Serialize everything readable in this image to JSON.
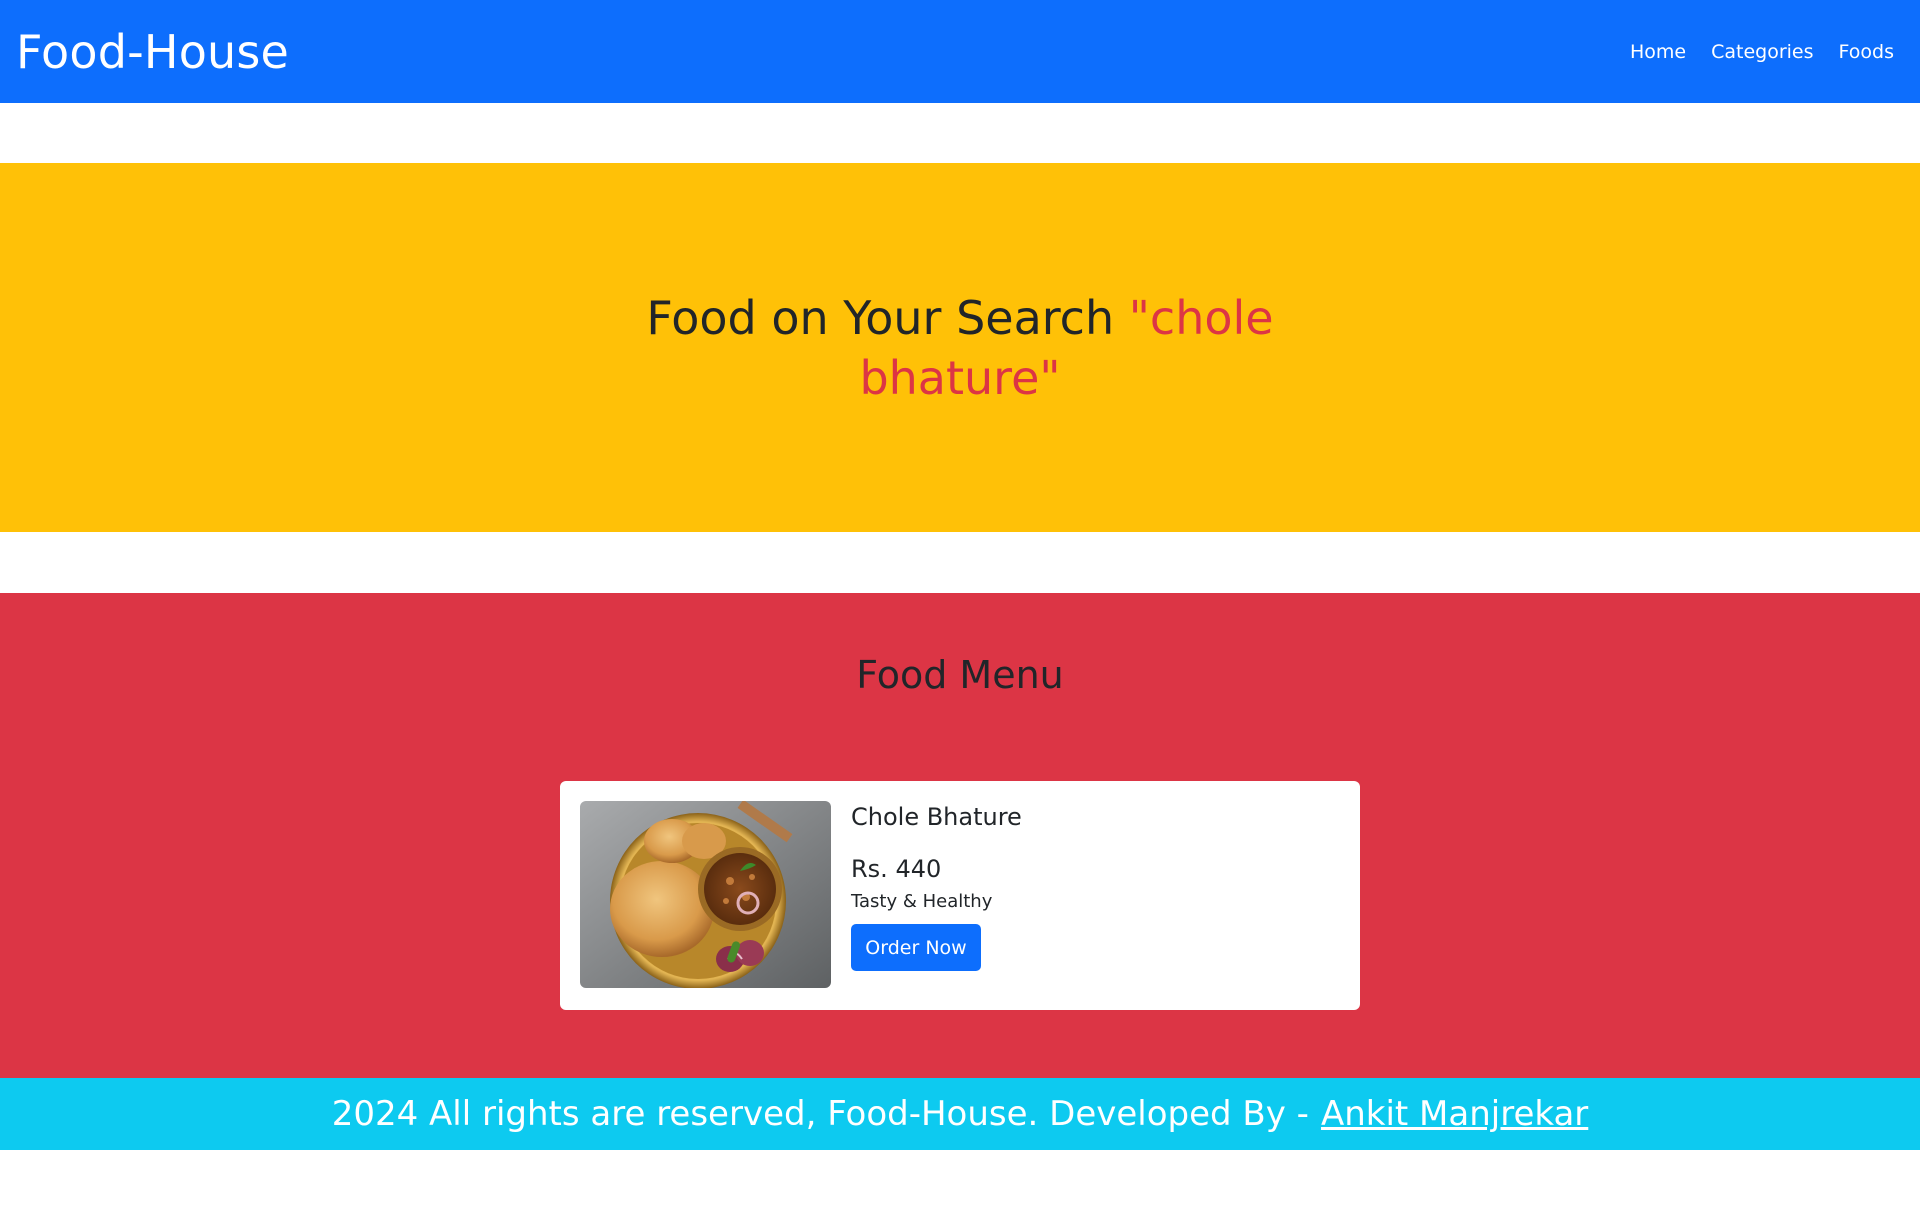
{
  "navbar": {
    "brand": "Food-House",
    "links": [
      "Home",
      "Categories",
      "Foods"
    ]
  },
  "hero": {
    "title_prefix": "Food on Your Search ",
    "query": "\"chole bhature\""
  },
  "menu": {
    "title": "Food Menu",
    "items": [
      {
        "name": "Chole Bhature",
        "price": "Rs. 440",
        "description": "Tasty & Healthy",
        "button": "Order Now"
      }
    ]
  },
  "footer": {
    "text": "2024 All rights are reserved, Food-House. Developed By -",
    "author": "Ankit Manjrekar"
  },
  "colors": {
    "primary": "#0d6efd",
    "warning": "#ffc107",
    "danger": "#dc3545",
    "info": "#0dcaf0"
  }
}
